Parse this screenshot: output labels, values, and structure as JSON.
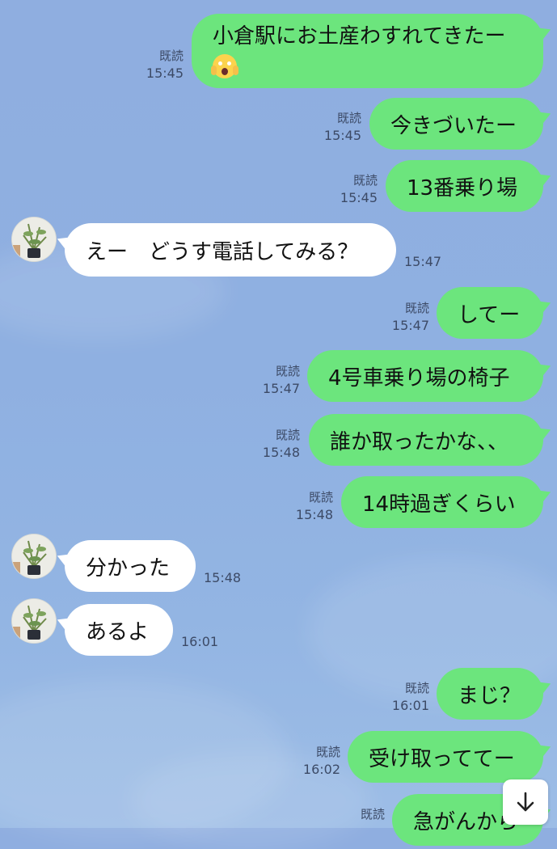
{
  "messages": [
    {
      "dir": "out",
      "read": "既読",
      "time": "15:45",
      "text": "小倉駅にお土産わすれてきたー",
      "emoji": "face-screaming-in-fear"
    },
    {
      "dir": "out",
      "read": "既読",
      "time": "15:45",
      "text": "今きづいたー"
    },
    {
      "dir": "out",
      "read": "既読",
      "time": "15:45",
      "text": "13番乗り場"
    },
    {
      "dir": "in",
      "time": "15:47",
      "text": "えー　どうす電話してみる？"
    },
    {
      "dir": "out",
      "read": "既読",
      "time": "15:47",
      "text": "してー"
    },
    {
      "dir": "out",
      "read": "既読",
      "time": "15:47",
      "text": "4号車乗り場の椅子"
    },
    {
      "dir": "out",
      "read": "既読",
      "time": "15:48",
      "text": "誰か取ったかな、、"
    },
    {
      "dir": "out",
      "read": "既読",
      "time": "15:48",
      "text": "14時過ぎくらい"
    },
    {
      "dir": "in",
      "time": "15:48",
      "text": "分かった"
    },
    {
      "dir": "in",
      "time": "16:01",
      "text": "あるよ"
    },
    {
      "dir": "out",
      "read": "既読",
      "time": "16:01",
      "text": "まじ？"
    },
    {
      "dir": "out",
      "read": "既読",
      "time": "16:02",
      "text": "受け取っててー"
    },
    {
      "dir": "out",
      "read": "既読",
      "time": "",
      "text": "急がんから"
    }
  ],
  "colors": {
    "background": "#8fb0e1",
    "out_bubble": "#6ce57d",
    "in_bubble": "#ffffff"
  },
  "icons": {
    "avatar": "potted-plant-avatar",
    "scroll": "arrow-down-icon"
  }
}
